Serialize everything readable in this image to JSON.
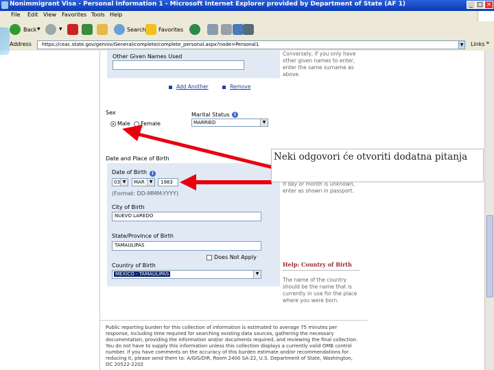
{
  "window": {
    "title": "Nonimmigrant Visa - Personal Information 1 - Microsoft Internet Explorer provided by Department of State (AF 1)",
    "btn_min": "_",
    "btn_max": "□",
    "btn_close": "×"
  },
  "menu": [
    "File",
    "Edit",
    "View",
    "Favorites",
    "Tools",
    "Help"
  ],
  "toolbar": {
    "back_label": "Back",
    "search_label": "Search",
    "favorites_label": "Favorites"
  },
  "address": {
    "label": "Address",
    "url": "https://ceac.state.gov/genniv/General/complete/complete_personal.aspx?node=Personal1",
    "links_label": "Links",
    "links_arrow": "»"
  },
  "form": {
    "other_names_label": "Other Given Names Used",
    "other_names_value": "",
    "other_names_help": "Conversely, if you only have other given names to enter, enter the same surname as above.",
    "add_another": "Add Another",
    "remove": "Remove",
    "sex_label": "Sex",
    "sex_male": "Male",
    "sex_female": "Female",
    "marital_label": "Marital Status",
    "marital_value": "MARRIED",
    "dob_section": "Date and Place of Birth",
    "dob_label": "Date of Birth",
    "dob_day": "03",
    "dob_month": "MAR",
    "dob_year": "1983",
    "dob_format": "(Format: DD-MMM-YYYY)",
    "dob_help": "If day or month is unknown, enter as shown in passport.",
    "city_label": "City of Birth",
    "city_value": "NUEVO LAREDO",
    "state_label": "State/Province of Birth",
    "state_value": "TAMAULIPAS",
    "does_not_apply": "Does Not Apply",
    "country_label": "Country of Birth",
    "country_value": "MEXICO - TAMAULIPAS",
    "help_title": "Help: Country of Birth",
    "help_text": "The name of the country should be the name that is currently in use for the place where you were born.",
    "burden_text": "Public reporting burden for this collection of information is estimated to average 75 minutes per response, including time required for searching existing data sources, gathering the necessary documentation, providing the information and/or documents required, and reviewing the final collection. You do not have to supply this information unless this collection displays a currently valid OMB control number. If you have comments on the accuracy of this burden estimate and/or recommendations for reducing it, please send them to: A/GIS/DIR, Room 2400 SA-22, U.S. Department of State, Washington, DC 20522-2202"
  },
  "callout": {
    "text": "Neki odgovori će otvoriti dodatna pitanja"
  },
  "colors": {
    "arrow": "#e8000f",
    "panel": "#e1e9f5",
    "titlebar": "#0a3ab8"
  }
}
